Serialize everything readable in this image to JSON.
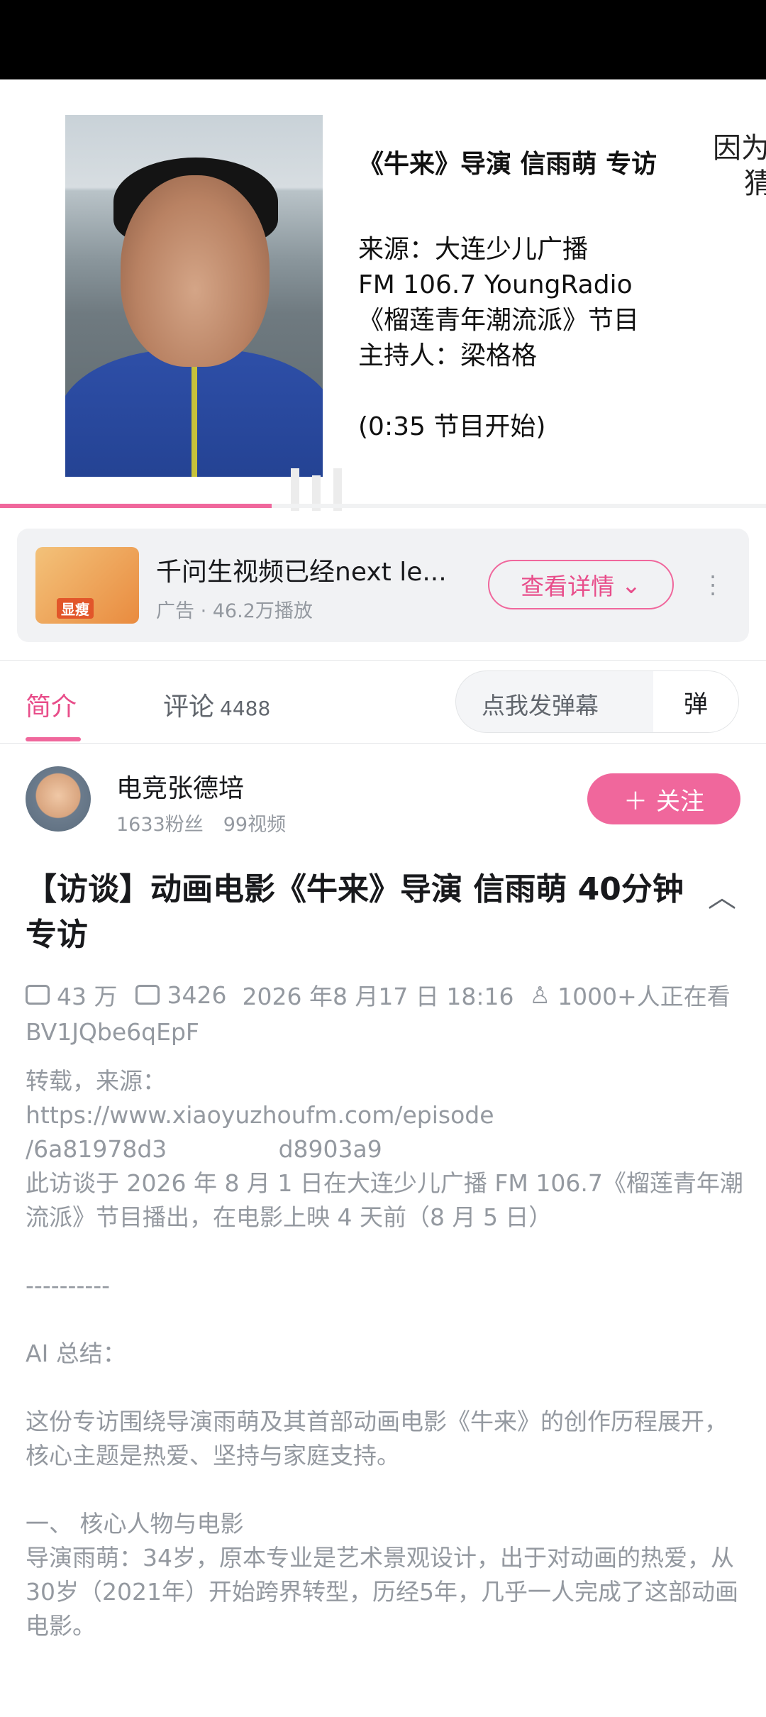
{
  "player": {
    "title": "《牛来》导演 信雨萌 专访",
    "source": "来源：大连少儿广播",
    "fm": "FM 106.7 YoungRadio",
    "program": "《榴莲青年潮流派》节目",
    "host": "主持人：梁格格",
    "start": "(0:35 节目开始)",
    "edge_text_1": "因为",
    "edge_text_2": "猜",
    "progress_fraction": 0.355
  },
  "ad": {
    "thumb_text": "显瘦",
    "title": "千问生视频已经next le...",
    "meta": "广告 · 46.2万播放",
    "button": "查看详情"
  },
  "tabs": {
    "intro": "简介",
    "comments": "评论",
    "comments_count": "4488",
    "danmaku_placeholder": "点我发弹幕",
    "danmaku_icon": "弹"
  },
  "uploader": {
    "name": "电竞张德培",
    "fans": "1633粉丝",
    "videos": "99视频",
    "follow": "关注"
  },
  "video": {
    "title": "【访谈】动画电影《牛来》导演 信雨萌 40分钟专访",
    "views": "43 万",
    "danmaku": "3426",
    "date": "2026 年8 月17 日 18:16",
    "watching": "1000+人正在看",
    "bv": "BV1JQbe6qEpF",
    "description": "转载，来源：\nhttps://www.xiaoyuzhoufm.com/episode\n/6a81978d3               d8903a9\n此访谈于 2026 年 8 月 1 日在大连少儿广播 FM 106.7《榴莲青年潮流派》节目播出，在电影上映 4 天前（8 月 5 日）\n\n----------\n\nAI 总结：\n\n这份专访围绕导演雨萌及其首部动画电影《牛来》的创作历程展开，核心主题是热爱、坚持与家庭支持。\n\n一、 核心人物与电影\n导演雨萌：34岁，原本专业是艺术景观设计，出于对动画的热爱，从30岁（2021年）开始跨界转型，历经5年，几乎一人完成了这部动画电影。"
  }
}
